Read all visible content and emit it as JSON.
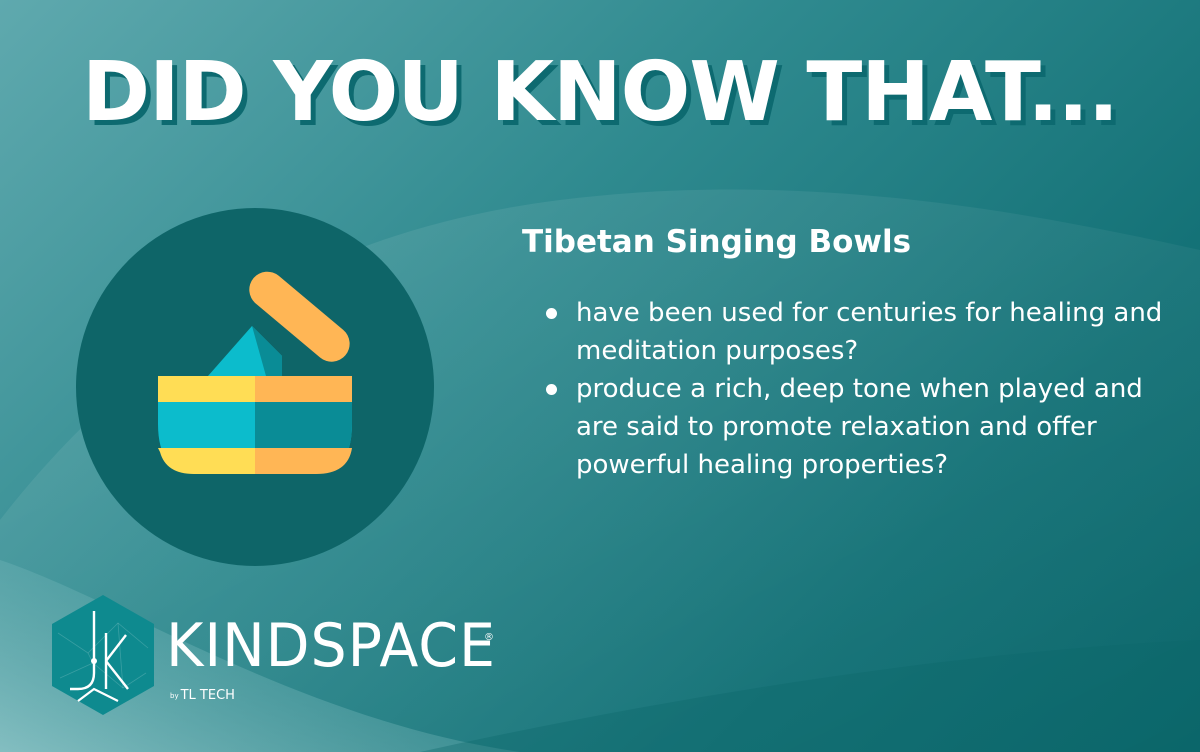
{
  "headline": "DID YOU KNOW THAT...",
  "topic": {
    "title": "Tibetan Singing Bowls",
    "facts": [
      "have been used for centuries for healing and meditation purposes?",
      "produce a rich, deep tone when played and are said to promote relaxation and offer powerful healing properties?"
    ]
  },
  "illustration": {
    "icon": "singing-bowl-icon"
  },
  "brand": {
    "logo_text": "KINDSPACE",
    "registered": "®",
    "by_prefix": "by",
    "by_text": "TL TECH"
  },
  "colors": {
    "background_light": "#5fa9ae",
    "background_dark": "#0b666a",
    "circle": "#0e6568",
    "bowl_yellow": "#ffdd55",
    "bowl_orange": "#ffb655",
    "bowl_cyan": "#0cbccc",
    "bowl_teal": "#0a8c96",
    "text": "#ffffff"
  }
}
